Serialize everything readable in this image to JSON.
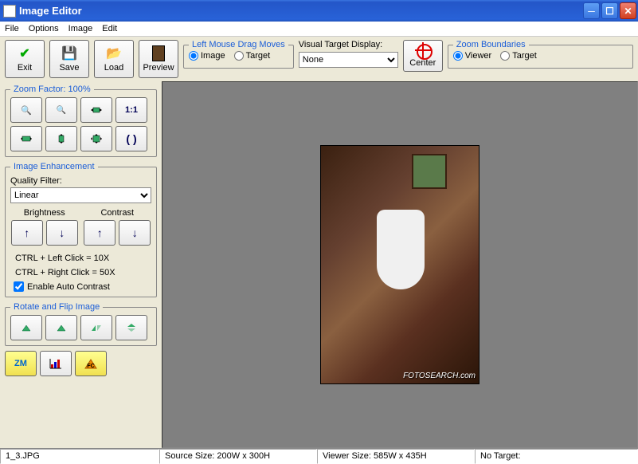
{
  "window": {
    "title": "Image Editor"
  },
  "menu": {
    "file": "File",
    "options": "Options",
    "image": "Image",
    "edit": "Edit"
  },
  "toolbar": {
    "exit": "Exit",
    "save": "Save",
    "load": "Load",
    "preview": "Preview"
  },
  "leftDrag": {
    "legend": "Left Mouse Drag Moves",
    "image": "Image",
    "target": "Target"
  },
  "vtd": {
    "label": "Visual Target Display:",
    "selected": "None",
    "options": [
      "None"
    ]
  },
  "center": {
    "label": "Center"
  },
  "zoomBound": {
    "legend": "Zoom Boundaries",
    "viewer": "Viewer",
    "target": "Target"
  },
  "zoomFactor": {
    "legend": "Zoom Factor: 100%",
    "oneToOne": "1:1",
    "refresh": "↻"
  },
  "enhance": {
    "legend": "Image Enhancement",
    "qfLabel": "Quality Filter:",
    "qfSelected": "Linear",
    "brightness": "Brightness",
    "contrast": "Contrast",
    "hint1": "CTRL + Left Click = 10X",
    "hint2": "CTRL + Right Click = 50X",
    "autoContrast": "Enable Auto Contrast"
  },
  "rotate": {
    "legend": "Rotate and Flip Image"
  },
  "bottom": {
    "zm": "ZM",
    "fc": "FC"
  },
  "preview": {
    "watermark": "FOTOSEARCH.com"
  },
  "status": {
    "file": "1_3.JPG",
    "src": "Source Size: 200W x 300H",
    "viewer": "Viewer Size: 585W x 435H",
    "target": "No Target:"
  }
}
